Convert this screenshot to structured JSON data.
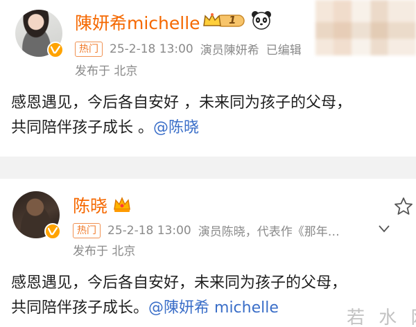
{
  "posts": [
    {
      "username": "陳妍希michelle",
      "hot_tag": "热门",
      "timestamp": "25-2-18 13:00",
      "source": "演员陳妍希",
      "edited": "已编辑",
      "location": "发布于 北京",
      "content_line1": "感恩遇见，今后各自安好 ，未来同为孩子的父母，",
      "content_line2": "共同陪伴孩子成长 。",
      "mention": "@陈晓",
      "level_badge": "1"
    },
    {
      "username": "陈晓",
      "hot_tag": "热门",
      "timestamp": "25-2-18 13:00",
      "source": "演员陈晓，代表作《那年…",
      "location": "发布于 北京",
      "content_line1": "感恩遇见，今后各自安好，未来同为孩子的父母，",
      "content_line2": "共同陪伴孩子成长。",
      "mention": "@陳妍希 michelle"
    }
  ],
  "watermark": "若 水 网",
  "colors": {
    "username": "#f56800",
    "mention": "#3a6ec8",
    "meta": "#8a8a8a",
    "hot_tag": "#f07a2a",
    "verified": "#ffa300"
  },
  "icons": [
    "verified-v-icon",
    "crown-level-badge-icon",
    "panda-icon",
    "crown-icon",
    "star-icon",
    "chevron-down-icon"
  ]
}
